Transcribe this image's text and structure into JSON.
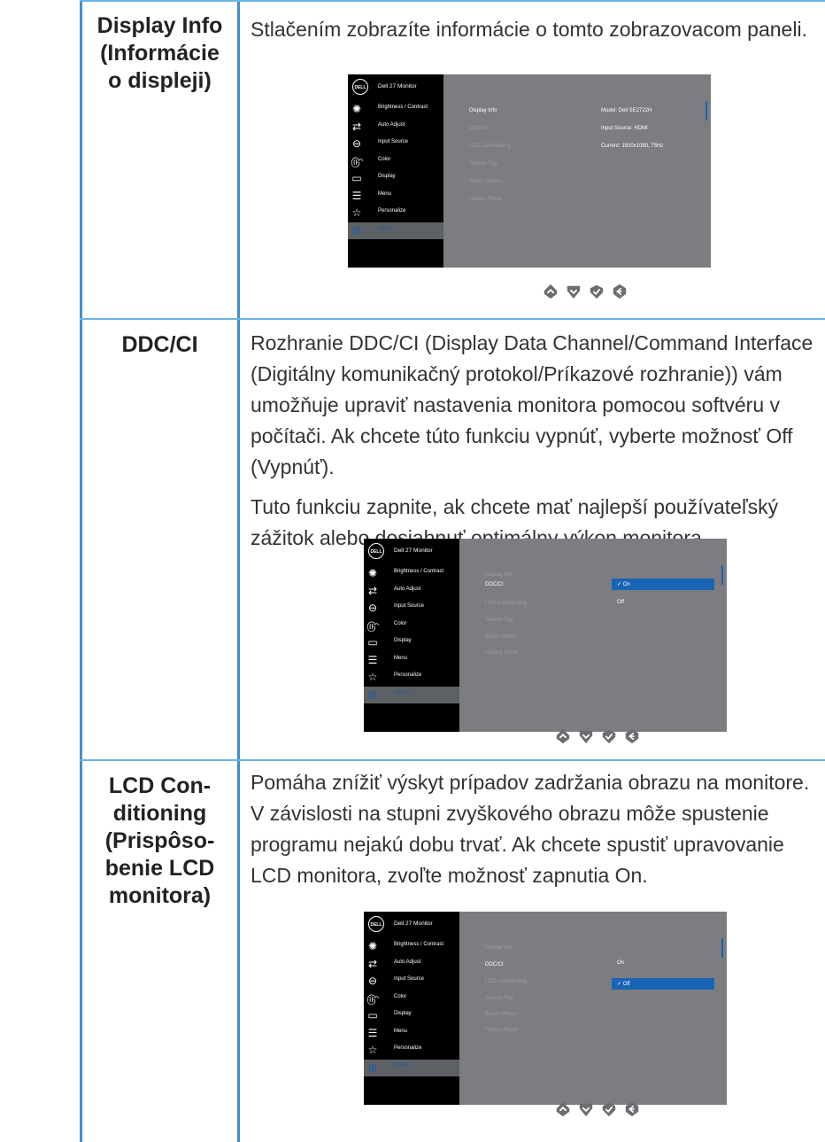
{
  "rows": [
    {
      "label": "Display Info\n(Informácie\no displeji)",
      "paragraphs": [
        "Stlačením zobrazíte informácie o tomto zobrazovacom paneli."
      ]
    },
    {
      "label": "DDC/CI",
      "paragraphs": [
        "Rozhranie DDC/CI (Display Data Channel/Command Interface (Digitálny komunikačný protokol/Príkazové rozhranie)) vám umožňuje upraviť nastavenia monitora pomocou softvéru v počítači. Ak chcete túto funkciu vypnúť, vyberte možnosť Off (Vypnúť).",
        "Tuto funkciu zapnite, ak chcete mať najlepší používateľský zážitok alebo dosiahnuť optimálny výkon monitora."
      ]
    },
    {
      "label": "LCD Con-\nditioning\n(Prispôso-\nbenie LCD\nmonitora)",
      "paragraphs": [
        "Pomáha znížiť výskyt prípadov zadržania obrazu na monitore. V závislosti na stupni zvyškového obrazu môže spustenie programu nejakú dobu trvať. Ak chcete spustiť upravovanie LCD monitora, zvoľte možnosť zapnutia On."
      ]
    }
  ],
  "osd": {
    "logo": "DELL",
    "title": "Dell 27 Monitor",
    "menu": [
      "Brightness / Contrast",
      "Auto Adjust",
      "Input Source",
      "Color",
      "Display",
      "Menu",
      "Personalize",
      "Others"
    ],
    "menu_icons": [
      "brightness-icon",
      "auto-adjust-icon",
      "input-source-icon",
      "color-icon",
      "display-icon",
      "menu-icon",
      "personalize-icon",
      "others-icon"
    ],
    "submenu": [
      "Display Info",
      "DDC/CI",
      "LCD Conditioning",
      "Service Tag",
      "Reset Others",
      "Factory Reset"
    ],
    "display_info_values": [
      "Model: Dell SE2722H",
      "Input Source: HDMI",
      "Current: 1920x1080, 75Hz"
    ],
    "ddc_options": [
      "On",
      "Off"
    ],
    "lcd_options": [
      "On",
      "Off"
    ],
    "check": "✓",
    "selected_menu_color": "#1a5ea8",
    "highlight_color": "#1964b4"
  },
  "nav_buttons": [
    "up-button",
    "down-button",
    "ok-button",
    "back-button"
  ]
}
